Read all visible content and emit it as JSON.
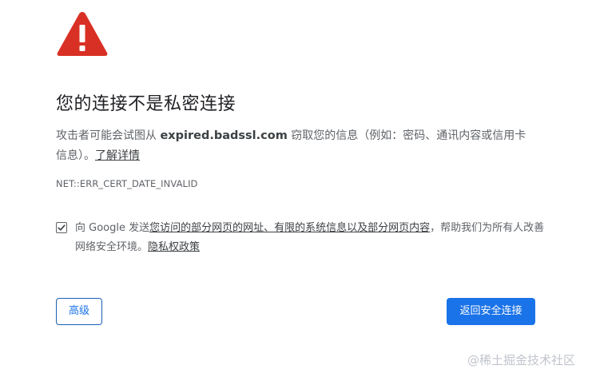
{
  "colors": {
    "warning_red": "#d93025",
    "primary_blue": "#1a73e8",
    "text_gray": "#5f6368"
  },
  "icons": {
    "warning": "warning-triangle-icon",
    "checkbox": "checkmark-icon"
  },
  "interstitial": {
    "title": "您的连接不是私密连接",
    "description": {
      "prefix": "攻击者可能会试图从 ",
      "host": "expired.badssl.com",
      "suffix": " 窃取您的信息（例如：密码、通讯内容或信用卡信息）。",
      "learn_more": "了解详情"
    },
    "error_code": "NET::ERR_CERT_DATE_INVALID",
    "optin": {
      "checked": true,
      "prefix": "向 Google 发送",
      "link1": "您访问的部分网页的网址、有限的系统信息以及部分网页内容",
      "middle": "，帮助我们为所有人改善网络安全环境。",
      "privacy_link": "隐私权政策"
    },
    "buttons": {
      "advanced": "高级",
      "back_to_safety": "返回安全连接"
    }
  },
  "watermark": "@稀土掘金技术社区"
}
